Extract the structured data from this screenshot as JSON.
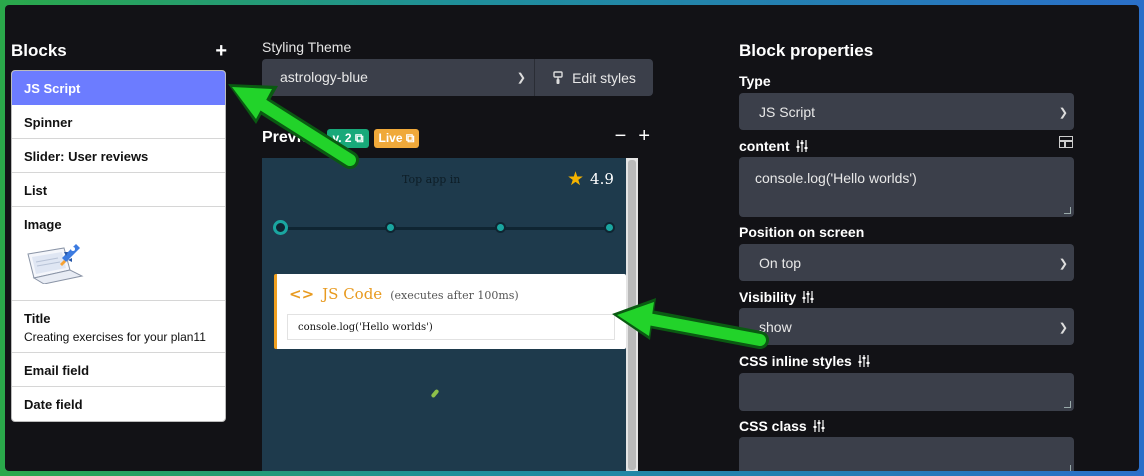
{
  "blocks": {
    "title": "Blocks",
    "add_label": "+",
    "items": [
      {
        "label": "JS Script"
      },
      {
        "label": "Spinner"
      },
      {
        "label": "Slider: User reviews"
      },
      {
        "label": "List"
      },
      {
        "label": "Image"
      },
      {
        "label": "Title",
        "sub": "Creating exercises for your plan11"
      },
      {
        "label": "Email field"
      },
      {
        "label": "Date field"
      }
    ]
  },
  "theme": {
    "label": "Styling Theme",
    "value": "astrology-blue",
    "edit_label": "Edit styles"
  },
  "preview": {
    "title": "Preview",
    "version_badge": "v. 2",
    "live_badge": "Live",
    "zoom_out": "−",
    "zoom_in": "+",
    "top_text": "Top app in",
    "rating": "4.9",
    "js_card": {
      "title": "JS Code",
      "note": "(executes after 100ms)",
      "code": "console.log('Hello worlds')"
    }
  },
  "props": {
    "title": "Block properties",
    "type_label": "Type",
    "type_value": "JS Script",
    "content_label": "content",
    "content_value": "console.log('Hello worlds')",
    "position_label": "Position on screen",
    "position_value": "On top",
    "visibility_label": "Visibility",
    "visibility_value": "show",
    "css_inline_label": "CSS inline styles",
    "css_class_label": "CSS class"
  },
  "colors": {
    "active_item": "#6c7cff",
    "arrow": "#22d32a",
    "badge_version": "#18a97a",
    "badge_live": "#f0a93a",
    "accent_orange": "#e89a1f"
  }
}
